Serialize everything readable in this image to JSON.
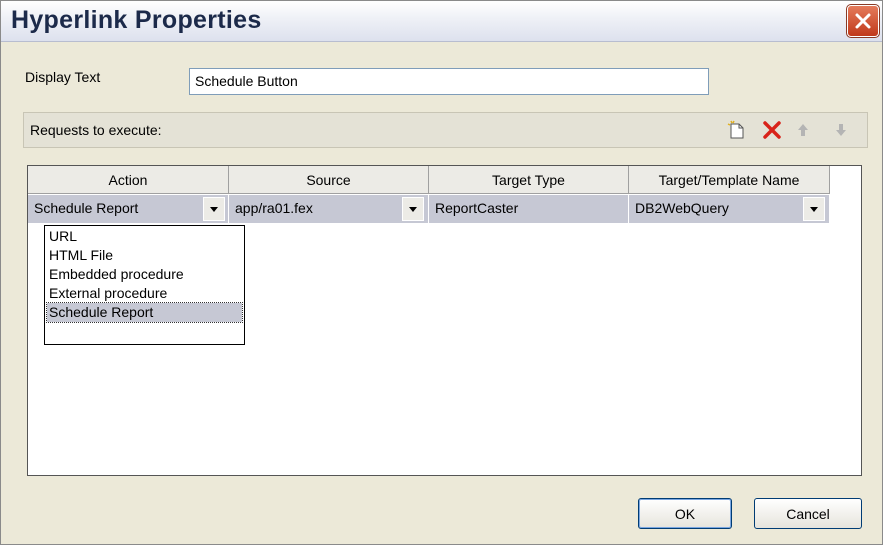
{
  "window": {
    "title": "Hyperlink Properties"
  },
  "form": {
    "display_text_label": "Display Text",
    "display_text_value": "Schedule Button",
    "requests_label": "Requests to execute:"
  },
  "grid": {
    "columns": [
      "Action",
      "Source",
      "Target Type",
      "Target/Template Name"
    ],
    "row": {
      "action": "Schedule Report",
      "source": "app/ra01.fex",
      "target_type": "ReportCaster",
      "target_name": "DB2WebQuery"
    },
    "action_options": [
      "URL",
      "HTML File",
      "Embedded procedure",
      "External procedure",
      "Schedule Report"
    ],
    "selected_option": "Schedule Report"
  },
  "buttons": {
    "ok": "OK",
    "cancel": "Cancel"
  },
  "icons": [
    "close-icon",
    "new-request-icon",
    "delete-icon",
    "move-up-icon",
    "move-down-icon",
    "dropdown-arrow-icon"
  ],
  "colors": {
    "close_button": "#d24a2a",
    "delete_icon": "#d8231a",
    "selected_row": "#c6c8d4"
  }
}
